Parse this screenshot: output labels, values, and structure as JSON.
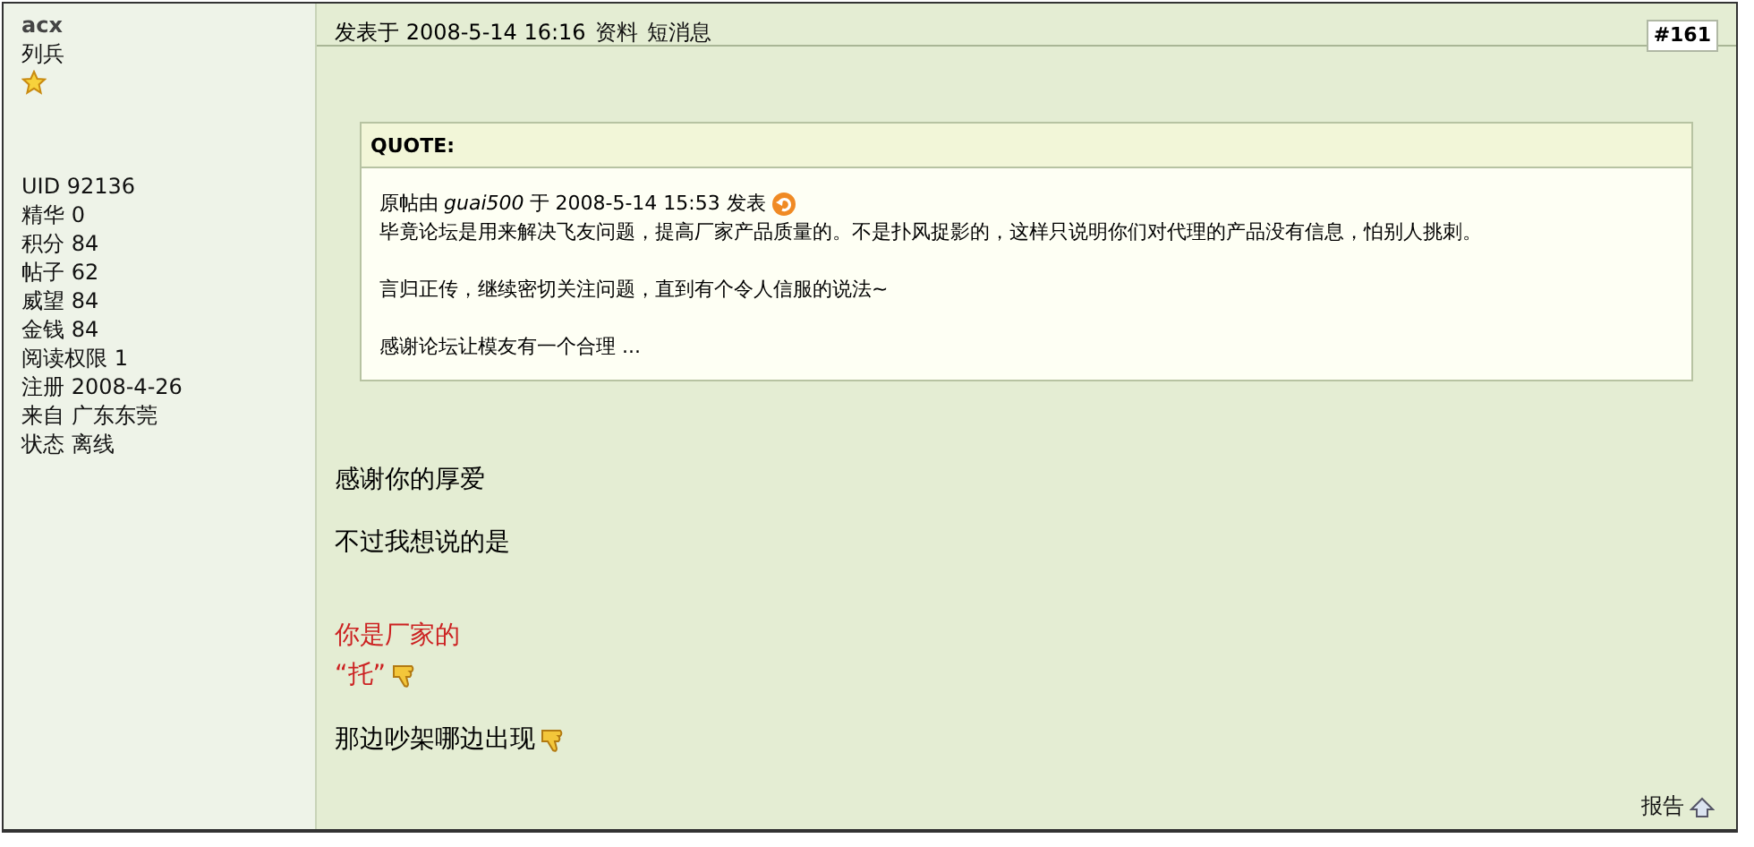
{
  "author": {
    "name": "acx",
    "rank": "列兵",
    "stats": [
      "UID 92136",
      "精华 0",
      "积分 84",
      "帖子 62",
      "威望 84",
      "金钱 84",
      "阅读权限 1",
      "注册 2008-4-26",
      "来自 广东东莞",
      "状态 离线"
    ]
  },
  "post": {
    "posted": "发表于 2008-5-14 16:16",
    "links": [
      "资料",
      "短消息"
    ],
    "number": "#161",
    "quote": {
      "label": "QUOTE:",
      "by": "原帖由",
      "author": "guai500",
      "when": "于 2008-5-14 15:53 发表",
      "paragraphs": [
        "毕竟论坛是用来解决飞友问题，提高厂家产品质量的。不是扑风捉影的，这样只说明你们对代理的产品没有信息，怕别人挑刺。",
        "言归正传，继续密切关注问题，直到有个令人信服的说法~",
        "感谢论坛让模友有一个合理 ..."
      ]
    },
    "blocks": [
      {
        "color": "#000000",
        "lines": [
          {
            "text": "感谢你的厚爱",
            "emoticon": false
          }
        ]
      },
      {
        "color": "#000000",
        "lines": [
          {
            "text": "不过我想说的是",
            "emoticon": false
          }
        ]
      },
      {
        "color": "#cc2222",
        "lines": [
          {
            "text": "你是厂家的",
            "emoticon": false
          },
          {
            "text": "“托”",
            "emoticon": true
          }
        ]
      },
      {
        "color": "#000000",
        "lines": [
          {
            "text": "那边吵架哪边出现",
            "emoticon": true
          }
        ]
      }
    ],
    "report": "报告"
  }
}
